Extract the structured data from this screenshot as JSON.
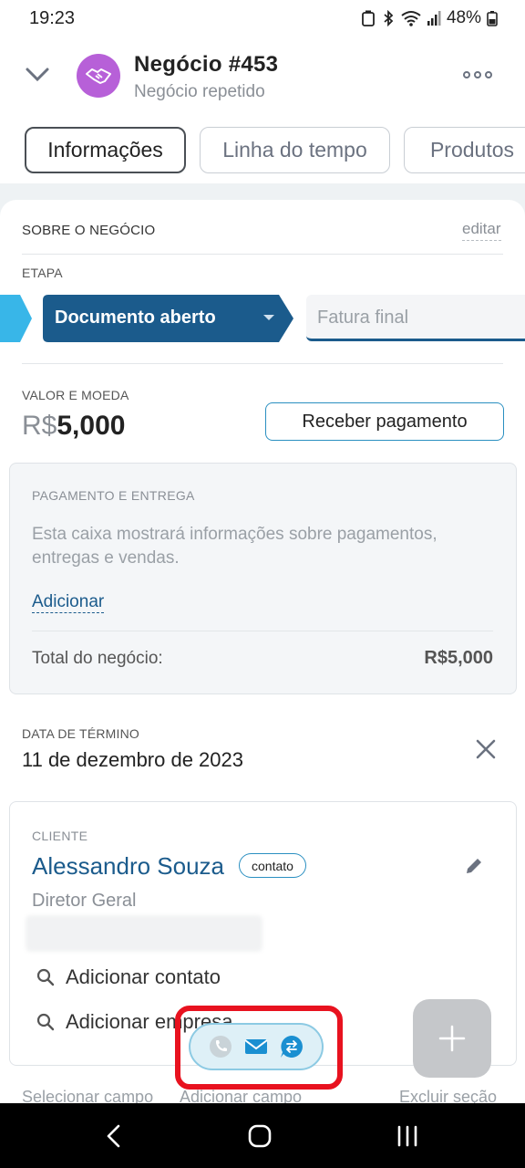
{
  "status": {
    "time": "19:23",
    "battery": "48%"
  },
  "header": {
    "title": "Negócio #453",
    "subtitle": "Negócio repetido",
    "avatar_color": "#b760d8"
  },
  "tabs": [
    {
      "label": "Informações",
      "active": true
    },
    {
      "label": "Linha do tempo",
      "active": false
    },
    {
      "label": "Produtos",
      "active": false
    }
  ],
  "about": {
    "section_title": "SOBRE O NEGÓCIO",
    "edit_label": "editar",
    "stage_label": "ETAPA",
    "stage_current": "Documento aberto",
    "stage_next": "Fatura final",
    "stage_color": "#1b5b8c"
  },
  "value": {
    "label": "VALOR E MOEDA",
    "currency": "R$",
    "amount": "5,000",
    "receive_button": "Receber pagamento"
  },
  "payment": {
    "label": "PAGAMENTO E ENTREGA",
    "description": "Esta caixa mostrará informações sobre pagamentos, entregas e vendas.",
    "add_link": "Adicionar",
    "total_label": "Total do negócio:",
    "total_value": "R$5,000"
  },
  "end_date": {
    "label": "DATA DE TÉRMINO",
    "value": "11 de dezembro de 2023"
  },
  "client": {
    "label": "CLIENTE",
    "name": "Alessandro Souza",
    "badge": "contato",
    "role": "Diretor Geral",
    "add_contact": "Adicionar contato",
    "add_company": "Adicionar empresa"
  },
  "footer": {
    "select_field": "Selecionar campo",
    "add_field": "Adicionar campo",
    "delete_section": "Excluir seção"
  },
  "icons": {
    "fab": "plus-icon",
    "call": "phone-icon",
    "mail": "envelope-icon",
    "chat": "chat-transfer-icon"
  }
}
